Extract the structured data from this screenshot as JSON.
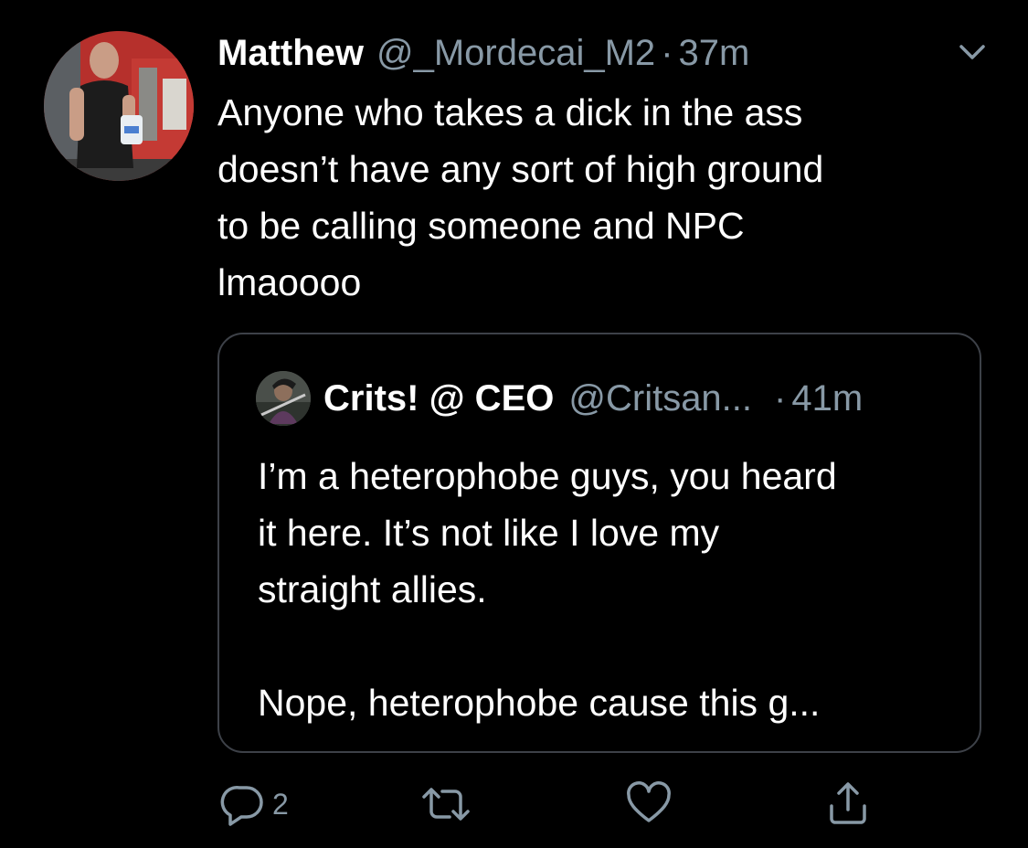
{
  "tweet": {
    "display_name": "Matthew",
    "handle": "@_Mordecai_M2",
    "separator": "·",
    "time": "37m",
    "text": "Anyone who takes a dick in the ass\ndoesn’t have any sort of high ground\nto be calling someone and NPC\nlmaoooo"
  },
  "quoted_tweet": {
    "display_name": "Crits! @ CEO",
    "handle": "@Critsan...",
    "separator": "·",
    "time": "41m",
    "text": "I’m a heterophobe guys, you heard\nit here. It’s not like I love my\nstraight allies.\n\nNope, heterophobe cause this g..."
  },
  "actions": {
    "reply_count": "2",
    "icons": [
      "reply-icon",
      "retweet-icon",
      "like-icon",
      "share-icon"
    ]
  },
  "colors": {
    "background": "#000000",
    "text": "#ffffff",
    "secondary": "#8899a6",
    "quote_border": "#3d4148"
  }
}
